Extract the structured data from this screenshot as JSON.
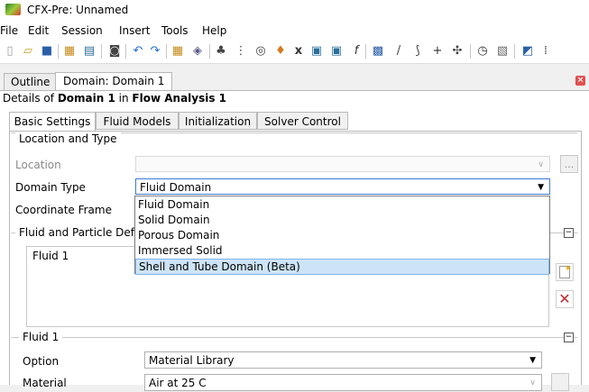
{
  "window": {
    "title": "CFX-Pre: Unnamed"
  },
  "menu": [
    "File",
    "Edit",
    "Session",
    "Insert",
    "Tools",
    "Help"
  ],
  "toolbar_icons": [
    "new-icon",
    "open-icon",
    "save-icon",
    "import-mesh-icon",
    "mesh-icon",
    "screenshot-icon",
    "undo-icon",
    "redo-icon",
    "mesh-import-icon",
    "domain-icon",
    "boundary-icon",
    "interface-icon",
    "subdomain-icon",
    "source-icon",
    "expression-icon",
    "function-icon",
    "user-function-icon",
    "material-icon",
    "line-icon",
    "particle-icon",
    "point-icon",
    "monitor-icon",
    "timer-icon",
    "output-icon",
    "solver-icon",
    "more-icon"
  ],
  "tabs": [
    {
      "label": "Outline"
    },
    {
      "label": "Domain: Domain 1"
    }
  ],
  "details": {
    "prefix": "Details of",
    "object": "Domain 1",
    "middle": "in",
    "parent": "Flow Analysis 1"
  },
  "subtabs": [
    {
      "label": "Basic Settings"
    },
    {
      "label": "Fluid Models"
    },
    {
      "label": "Initialization"
    },
    {
      "label": "Solver Control"
    }
  ],
  "location_and_type": {
    "group_label": "Location and Type",
    "location_label": "Location",
    "location_value": "",
    "location_button": "...",
    "domain_type_label": "Domain Type",
    "domain_type_value": "Fluid Domain",
    "coordinate_frame_label": "Coordinate Frame"
  },
  "domain_type_options": [
    "Fluid Domain",
    "Solid Domain",
    "Porous Domain",
    "Immersed Solid",
    "Shell and Tube Domain (Beta)"
  ],
  "highlighted_option": "Shell and Tube Domain (Beta)",
  "fluid_particle": {
    "group_label": "Fluid and Particle Defin",
    "items": [
      "Fluid 1"
    ]
  },
  "fluid1": {
    "group_label": "Fluid 1",
    "option_label": "Option",
    "option_value": "Material Library",
    "material_label": "Material",
    "material_value": "Air at 25 C"
  },
  "colors": {
    "accent": "#3a7bd5",
    "highlight": "#cde4f7",
    "delete": "#c0282d"
  }
}
